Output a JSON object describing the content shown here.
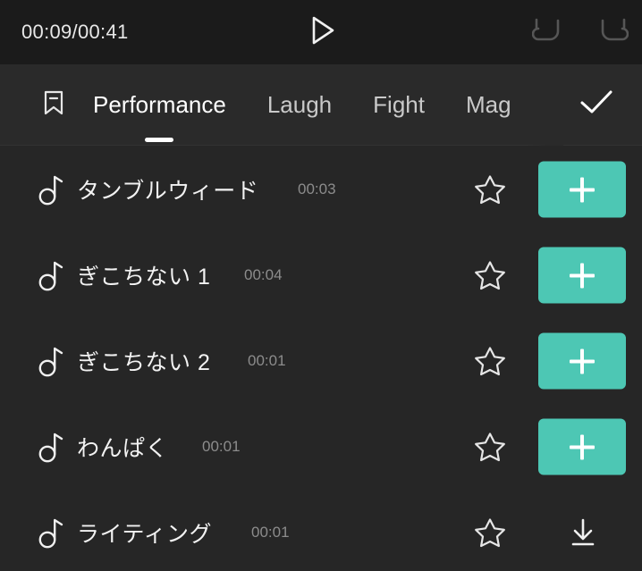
{
  "topbar": {
    "time_display": "00:09/00:41",
    "play_icon": "play-icon",
    "undo_icon": "undo-icon",
    "redo_icon": "redo-icon"
  },
  "tabbar": {
    "bookmark_icon": "bookmark-icon",
    "confirm_icon": "check-icon",
    "active_tab": "Performance",
    "tabs": [
      {
        "label": "Performance",
        "active": true
      },
      {
        "label": "Laugh",
        "active": false
      },
      {
        "label": "Fight",
        "active": false
      },
      {
        "label": "Mag",
        "active": false
      }
    ]
  },
  "sound_list": {
    "note_icon": "music-note-icon",
    "star_icon": "star-outline-icon",
    "add_icon": "plus-icon",
    "download_icon": "download-icon",
    "rows": [
      {
        "title": "タンブルウィード",
        "duration": "00:03",
        "action": "add",
        "favorited": false
      },
      {
        "title": "ぎこちない 1",
        "duration": "00:04",
        "action": "add",
        "favorited": false
      },
      {
        "title": "ぎこちない 2",
        "duration": "00:01",
        "action": "add",
        "favorited": false
      },
      {
        "title": "わんぱく",
        "duration": "00:01",
        "action": "add",
        "favorited": false
      },
      {
        "title": "ライティング",
        "duration": "00:01",
        "action": "download",
        "favorited": false
      }
    ]
  },
  "colors": {
    "accent_teal": "#4dc7b4",
    "topbar_bg": "#1b1b1b",
    "tabbar_bg": "#2a2a2a",
    "list_bg": "#262626",
    "text_primary": "#f2f2f2",
    "text_muted": "#8c8c8c",
    "icon_disabled": "#565656"
  }
}
